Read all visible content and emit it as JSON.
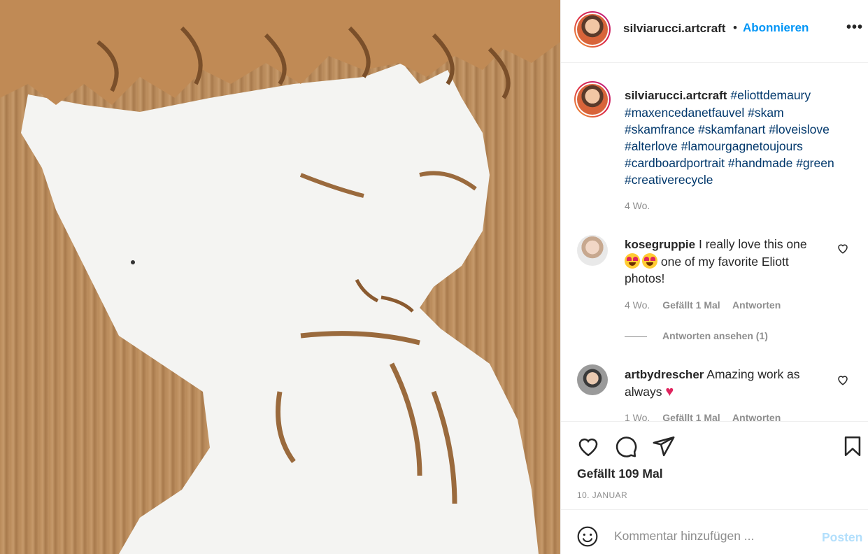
{
  "post": {
    "username": "silviarucci.artcraft",
    "separator": "•",
    "follow_label": "Abonnieren",
    "more_icon": "more-options-icon",
    "caption_tags": [
      "#eliottdemaury",
      "#maxencedanetfauvel",
      "#skam",
      "#skamfrance",
      "#skamfanart",
      "#loveislove",
      "#alterlove",
      "#lamourgagnetoujours",
      "#cardboardportrait",
      "#handmade",
      "#green",
      "#creativerecycle"
    ],
    "caption_time": "4 Wo."
  },
  "comments": [
    {
      "username": "kosegruppie",
      "text_before": "I really love this one",
      "text_after": "one of my favorite Eliott photos!",
      "emoji": "heart-eyes-emoji",
      "time": "4 Wo.",
      "likes": "Gefällt 1 Mal",
      "reply": "Antworten",
      "view_replies": "Antworten ansehen (1)"
    },
    {
      "username": "artbydrescher",
      "text": "Amazing work as always",
      "emoji": "red-heart-emoji",
      "time": "1 Wo.",
      "likes": "Gefällt 1 Mal",
      "reply": "Antworten"
    }
  ],
  "actions": {
    "icons": [
      "like-icon",
      "comment-icon",
      "share-icon",
      "save-icon"
    ],
    "likes": "Gefällt 109 Mal",
    "date": "10. JANUAR"
  },
  "composer": {
    "placeholder": "Kommentar hinzufügen ...",
    "post_label": "Posten",
    "emoji_icon": "emoji-icon"
  },
  "colors": {
    "accent": "#0095f6",
    "hashtag": "#00376b",
    "muted": "#8e8e8e",
    "post_disabled": "#b2dffc",
    "cardboard": "#b98a5a"
  }
}
